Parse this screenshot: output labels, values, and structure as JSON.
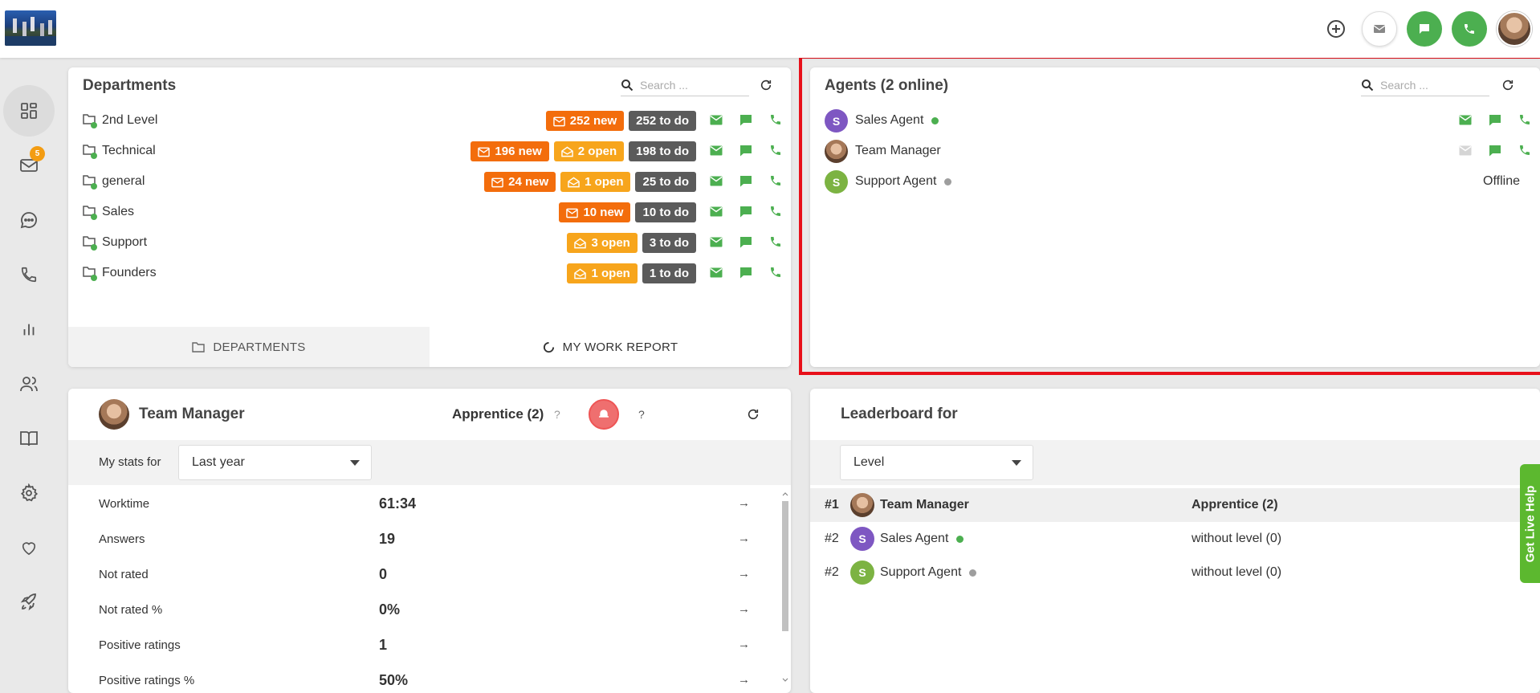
{
  "colors": {
    "accent_green": "#4caf50",
    "new_orange": "#f36d0c",
    "open_yellow": "#f7a51c",
    "todo_gray": "#5b5b5b",
    "highlight_red": "#e8101a"
  },
  "topbar": {
    "icons": [
      "add-icon",
      "mail-icon",
      "chat-icon",
      "phone-icon",
      "avatar"
    ]
  },
  "sidebar": {
    "items": [
      "dashboard-icon",
      "mail-icon",
      "chat-icon",
      "phone-icon",
      "reports-icon",
      "users-icon",
      "knowledgebase-icon",
      "settings-icon",
      "heart-icon",
      "rocket-icon"
    ],
    "mail_badge": "5"
  },
  "departments": {
    "title": "Departments",
    "search_placeholder": "Search ...",
    "rows": [
      {
        "name": "2nd Level",
        "new": "252 new",
        "open": "",
        "todo": "252 to do"
      },
      {
        "name": "Technical",
        "new": "196 new",
        "open": "2 open",
        "todo": "198 to do"
      },
      {
        "name": "general",
        "new": "24 new",
        "open": "1 open",
        "todo": "25 to do"
      },
      {
        "name": "Sales",
        "new": "10 new",
        "open": "",
        "todo": "10 to do"
      },
      {
        "name": "Support",
        "new": "",
        "open": "3 open",
        "todo": "3 to do"
      },
      {
        "name": "Founders",
        "new": "",
        "open": "1 open",
        "todo": "1 to do"
      }
    ],
    "tabs": {
      "departments": "DEPARTMENTS",
      "work_report": "MY WORK REPORT"
    }
  },
  "agents": {
    "title": "Agents (2 online)",
    "search_placeholder": "Search ...",
    "rows": [
      {
        "initial": "S",
        "name": "Sales Agent",
        "status": "online",
        "offline_label": ""
      },
      {
        "initial": "",
        "name": "Team Manager",
        "status": "none",
        "offline_label": ""
      },
      {
        "initial": "S",
        "name": "Support Agent",
        "status": "offline",
        "offline_label": "Offline"
      }
    ]
  },
  "team_manager": {
    "name": "Team Manager",
    "level": "Apprentice (2)",
    "q1": "?",
    "q2": "?",
    "stats_label": "My stats for",
    "period": "Last year",
    "stats": [
      {
        "label": "Worktime",
        "value": "61:34"
      },
      {
        "label": "Answers",
        "value": "19"
      },
      {
        "label": "Not rated",
        "value": "0"
      },
      {
        "label": "Not rated %",
        "value": "0%"
      },
      {
        "label": "Positive ratings",
        "value": "1"
      },
      {
        "label": "Positive ratings %",
        "value": "50%"
      }
    ],
    "arrow": "→"
  },
  "leaderboard": {
    "title": "Leaderboard for",
    "filter": "Level",
    "rows": [
      {
        "rank": "#1",
        "initial": "",
        "name": "Team Manager",
        "level": "Apprentice (2)"
      },
      {
        "rank": "#2",
        "initial": "S",
        "name": "Sales Agent",
        "level": "without level (0)"
      },
      {
        "rank": "#2",
        "initial": "S",
        "name": "Support Agent",
        "level": "without level (0)"
      }
    ]
  },
  "live_help": "Get Live Help"
}
